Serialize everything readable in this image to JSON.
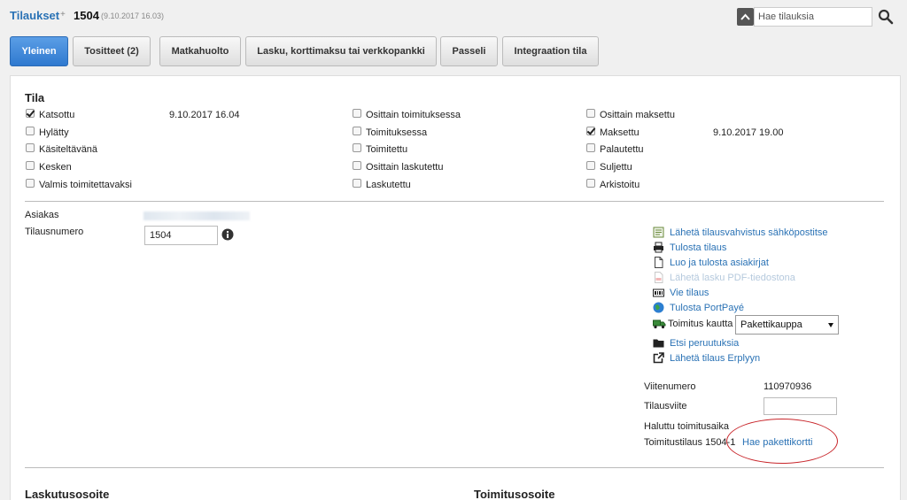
{
  "breadcrumb": {
    "link": "Tilaukset",
    "separator": "+",
    "order_number": "1504",
    "order_date": "(9.10.2017 16.03)"
  },
  "search": {
    "placeholder": "Hae tilauksia"
  },
  "tabs": [
    {
      "label": "Yleinen",
      "active": true
    },
    {
      "label": "Tositteet (2)"
    },
    {
      "label": "Matkahuolto"
    },
    {
      "label": "Lasku, korttimaksu tai verkkopankki"
    },
    {
      "label": "Passeli"
    },
    {
      "label": "Integraation tila"
    }
  ],
  "status": {
    "heading": "Tila",
    "col1": [
      {
        "label": "Katsottu",
        "checked": true,
        "timestamp": "9.10.2017 16.04"
      },
      {
        "label": "Hylätty",
        "checked": false
      },
      {
        "label": "Käsiteltävänä",
        "checked": false
      },
      {
        "label": "Kesken",
        "checked": false
      },
      {
        "label": "Valmis toimitettavaksi",
        "checked": false
      }
    ],
    "col2": [
      {
        "label": "Osittain toimituksessa",
        "checked": false
      },
      {
        "label": "Toimituksessa",
        "checked": false
      },
      {
        "label": "Toimitettu",
        "checked": false
      },
      {
        "label": "Osittain laskutettu",
        "checked": false
      },
      {
        "label": "Laskutettu",
        "checked": false
      }
    ],
    "col3": [
      {
        "label": "Osittain maksettu",
        "checked": false
      },
      {
        "label": "Maksettu",
        "checked": true,
        "timestamp": "9.10.2017 19.00"
      },
      {
        "label": "Palautettu",
        "checked": false
      },
      {
        "label": "Suljettu",
        "checked": false
      },
      {
        "label": "Arkistoitu",
        "checked": false
      }
    ]
  },
  "customer": {
    "asiakas_label": "Asiakas",
    "tilausnumero_label": "Tilausnumero",
    "tilausnumero_value": "1504"
  },
  "actions": [
    {
      "label": "Lähetä tilausvahvistus sähköpostitse",
      "icon": "send-mail-icon"
    },
    {
      "label": "Tulosta tilaus",
      "icon": "printer-icon"
    },
    {
      "label": "Luo ja tulosta asiakirjat",
      "icon": "document-icon"
    },
    {
      "label": "Lähetä lasku PDF-tiedostona",
      "icon": "pdf-icon",
      "disabled": true
    },
    {
      "label": "Vie tilaus",
      "icon": "export-icon"
    },
    {
      "label": "Tulosta PortPayé",
      "icon": "globe-icon"
    },
    {
      "label": "Etsi peruutuksia",
      "icon": "folder-icon"
    },
    {
      "label": "Lähetä tilaus Erplyyn",
      "icon": "external-link-icon"
    }
  ],
  "shipping": {
    "label": "Toimitus kautta",
    "selected": "Pakettikauppa"
  },
  "order_info": {
    "viitenumero_label": "Viitenumero",
    "viitenumero_value": "110970936",
    "tilausviite_label": "Tilausviite",
    "toimitusaika_label": "Haluttu toimitusaika",
    "toimitustilaus_label": "Toimitustilaus 1504-1",
    "hae_link": "Hae pakettikortti"
  },
  "sections": {
    "laskutus": "Laskutusosoite",
    "toimitus": "Toimitusosoite"
  },
  "colors": {
    "accent": "#2a72b5",
    "tab_active": "#3a84d6",
    "highlight_circle": "#c8262b"
  }
}
